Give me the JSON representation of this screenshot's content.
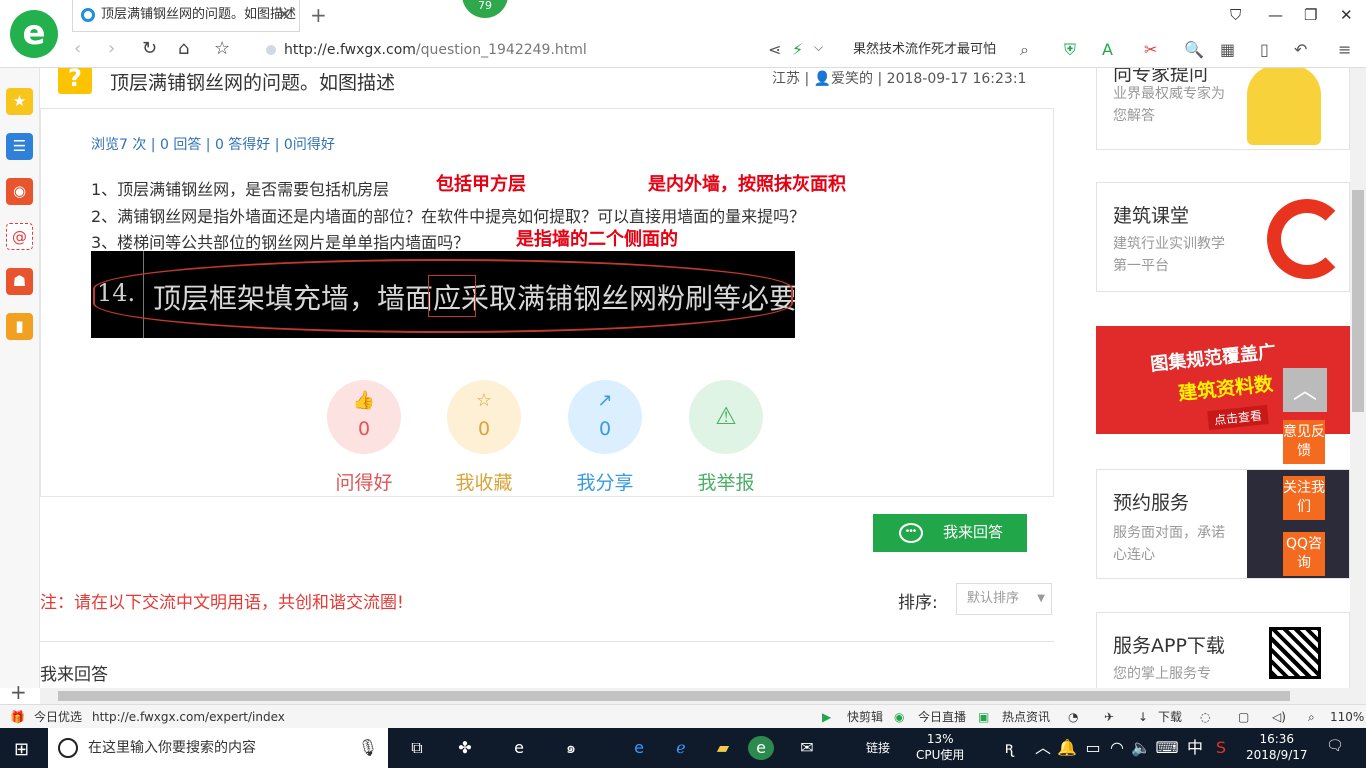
{
  "browser": {
    "tab_title": "顶层满铺钢丝网的问题。如图描述",
    "badge": "79",
    "url_host": "http://e.fwxgx.com",
    "url_path": "/question_1942249.html",
    "news_ticker": "果然技术流作死才最可怕"
  },
  "question": {
    "title": "顶层满铺钢丝网的问题。如图描述",
    "meta": "江苏 | 👤爱笑的 | 2018-09-17 16:23:1",
    "stats": "浏览7 次 | 0 回答 | 0 答得好 | 0问得好",
    "line1": "1、顶层满铺钢丝网，是否需要包括机房层",
    "line1_note_a": "包括甲方层",
    "line1_note_b": "是内外墙，按照抹灰面积",
    "line2": "2、满铺钢丝网是指外墙面还是内墙面的部位？在软件中提亮如何提取？可以直接用墙面的量来提吗？",
    "line3": "3、楼梯间等公共部位的钢丝网片是单单指内墙面吗？",
    "line3_note": "是指墙的二个侧面的",
    "image_num": "14.",
    "image_text": "顶层框架填充墙，墙面应采取满铺钢丝网粉刷等必要的措施。"
  },
  "actions": [
    {
      "icon": "👍",
      "count": "0",
      "label": "问得好"
    },
    {
      "icon": "☆",
      "count": "0",
      "label": "我收藏"
    },
    {
      "icon": "↗",
      "count": "0",
      "label": "我分享"
    },
    {
      "icon": "⚠",
      "count": "",
      "label": "我举报"
    }
  ],
  "answer_button": "我来回答",
  "notice": "注：请在以下交流中文明用语，共创和谐交流圈!",
  "sort": {
    "label": "排序:",
    "selected": "默认排序"
  },
  "my_answer": "我来回答",
  "right": {
    "card1_title": "向专家提问",
    "card1_sub": "业界最权威专家为您解答",
    "card2_title": "建筑课堂",
    "card2_sub": "建筑行业实训教学第一平台",
    "banner_line1": "图集规范覆盖广",
    "banner_line2": "建筑资料数",
    "banner_line3": "点击查看",
    "card3_title": "预约服务",
    "card3_sub": "服务面对面，承诺心连心",
    "card4_title": "服务APP下载",
    "card4_sub": "您的掌上服务专"
  },
  "float_tools": {
    "feedback": "意见反馈",
    "follow": "关注我们",
    "qq": "QQ咨询"
  },
  "statusbar": {
    "today": "今日优选",
    "url": "http://e.fwxgx.com/expert/index",
    "kuaijian": "快剪辑",
    "live": "今日直播",
    "hot": "热点资讯",
    "download": "下载",
    "zoom": "110%"
  },
  "taskbar": {
    "search_placeholder": "在这里输入你要搜索的内容",
    "link": "链接",
    "cpu_pct": "13%",
    "cpu_label": "CPU使用",
    "ime": "中",
    "time": "16:36",
    "date": "2018/9/17"
  },
  "colors": {
    "brand_green": "#21a74a",
    "question_red": "#e60012",
    "float_orange": "#f46b1f"
  }
}
